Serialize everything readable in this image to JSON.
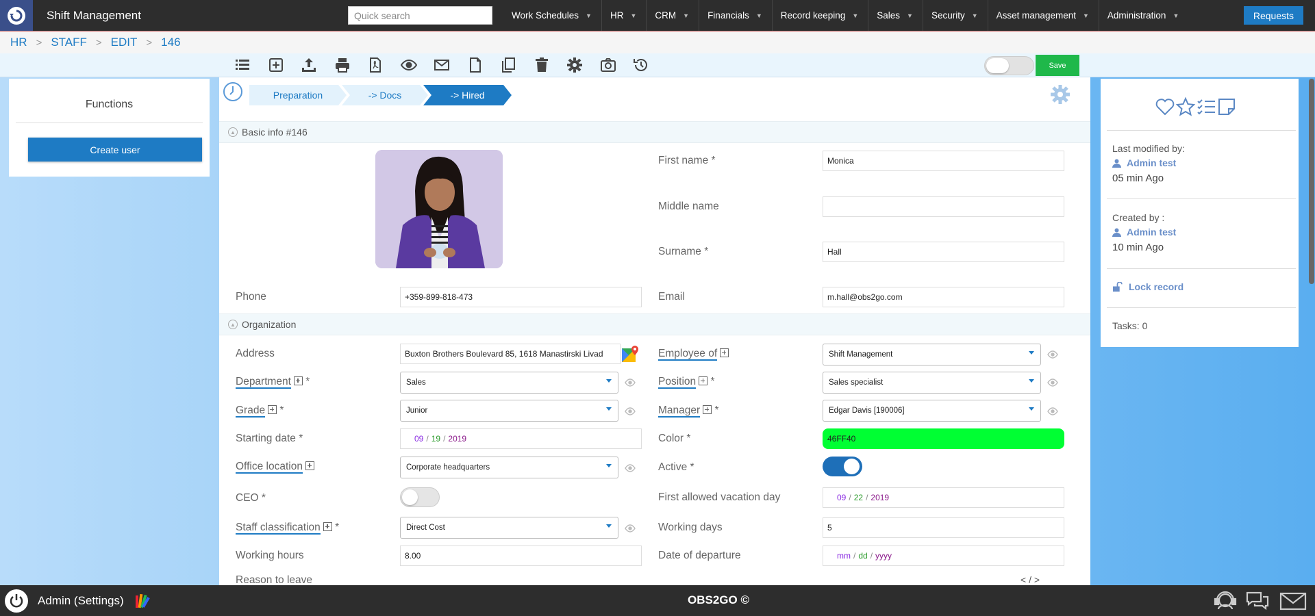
{
  "app": {
    "title": "Shift Management",
    "requests": "Requests",
    "search_placeholder": "Quick search"
  },
  "nav": [
    "Work Schedules",
    "HR",
    "CRM",
    "Financials",
    "Record keeping",
    "Sales",
    "Security",
    "Asset management",
    "Administration"
  ],
  "breadcrumb": [
    "HR",
    "STAFF",
    "EDIT",
    "146"
  ],
  "toolbar": {
    "save": "Save"
  },
  "left": {
    "title": "Functions",
    "create_user": "Create user"
  },
  "steps": [
    "Preparation",
    "-> Docs",
    "-> Hired"
  ],
  "sections": {
    "basic": "Basic info #146",
    "org": "Organization"
  },
  "form": {
    "first_name_label": "First name *",
    "first_name": "Monica",
    "middle_name_label": "Middle name",
    "middle_name": "",
    "surname_label": "Surname *",
    "surname": "Hall",
    "phone_label": "Phone",
    "phone": "+359-899-818-473",
    "email_label": "Email",
    "email": "m.hall@obs2go.com",
    "address_label": "Address",
    "address": "Buxton Brothers Boulevard 85, 1618 Manastirski Livad",
    "employee_of_label": "Employee of",
    "employee_of": "Shift Management",
    "department_label": "Department",
    "department": "Sales",
    "position_label": "Position",
    "position": "Sales specialist",
    "grade_label": "Grade",
    "grade": "Junior",
    "manager_label": "Manager",
    "manager": "Edgar Davis [190006]",
    "starting_date_label": "Starting date *",
    "start_m": "09",
    "start_d": "19",
    "start_y": "2019",
    "color_label": "Color *",
    "color": "46FF40",
    "office_location_label": "Office location",
    "office_location": "Corporate headquarters",
    "active_label": "Active *",
    "ceo_label": "CEO *",
    "first_vacation_label": "First allowed vacation day",
    "vac_m": "09",
    "vac_d": "22",
    "vac_y": "2019",
    "staff_class_label": "Staff classification",
    "staff_class": "Direct Cost",
    "working_days_label": "Working days",
    "working_days": "5",
    "working_hours_label": "Working hours",
    "working_hours": "8.00",
    "departure_label": "Date of departure",
    "dep_m": "mm",
    "dep_d": "dd",
    "dep_y": "yyyy",
    "reason_label": "Reason to leave",
    "code_tag": "< / >",
    "star": "*",
    "date_sep": "/"
  },
  "right": {
    "last_modified_label": "Last modified by:",
    "last_modified_user": "Admin test",
    "last_modified_time": "05 min Ago",
    "created_label": "Created by :",
    "created_user": "Admin test",
    "created_time": "10 min Ago",
    "lock": "Lock record",
    "tasks": "Tasks: 0"
  },
  "footer": {
    "admin": "Admin (Settings)",
    "brand": "OBS2GO ©"
  },
  "colors": {
    "accent": "#1e7bc4",
    "save": "#1fb84a",
    "color_field": "#00ff33"
  }
}
